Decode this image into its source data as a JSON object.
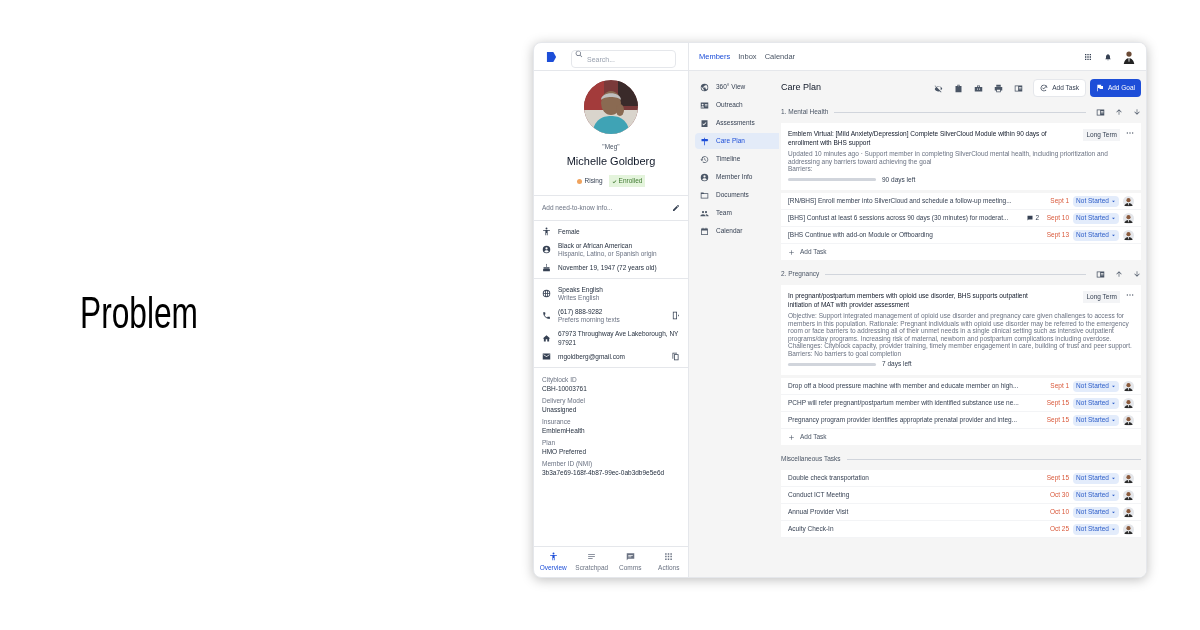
{
  "slide_title": "Problem",
  "app": {
    "search": {
      "placeholder": "Search..."
    },
    "top_tabs": [
      {
        "label": "Members",
        "selected": true
      },
      {
        "label": "Inbox",
        "selected": false
      },
      {
        "label": "Calendar",
        "selected": false
      }
    ],
    "member": {
      "nickname": "\"Meg\"",
      "name": "Michelle Goldberg",
      "status": {
        "label": "Rising",
        "color": "#f0a35e"
      },
      "badge": "Enrolled",
      "need_to_know": {
        "placeholder": "Add need-to-know info..."
      },
      "groups": [
        [
          {
            "kind": "gender",
            "text": "Female"
          },
          {
            "kind": "person",
            "text": "Black or African American",
            "sub": "Hispanic, Latino, or Spanish origin"
          },
          {
            "kind": "birthday",
            "text": "November 19, 1947 (72 years old)"
          }
        ],
        [
          {
            "kind": "language",
            "text": "Speaks English",
            "sub": "Writes English"
          },
          {
            "kind": "phone",
            "text": "(617) 888-9282",
            "sub": "Prefers morning texts"
          },
          {
            "kind": "home",
            "text": "67973 Throughway Ave Lakeborough, NY 97921"
          },
          {
            "kind": "email",
            "text": "mgoldberg@gmail.com"
          }
        ]
      ],
      "details": [
        {
          "label": "Cityblock ID",
          "value": "CBH-10003761"
        },
        {
          "label": "Delivery Model",
          "value": "Unassigned"
        },
        {
          "label": "Insurance",
          "value": "EmblemHealth"
        },
        {
          "label": "Plan",
          "value": "HMO Preferred"
        },
        {
          "label": "Member ID (NMI)",
          "value": "3b3a7e69-168f-4b87-99ec-0ab3db9e5e6d"
        }
      ]
    },
    "bottom_tabs": [
      {
        "kind": "overview",
        "label": "Overview",
        "selected": true
      },
      {
        "kind": "scratchpad",
        "label": "Scratchpad",
        "selected": false
      },
      {
        "kind": "comms",
        "label": "Comms",
        "selected": false
      },
      {
        "kind": "actions",
        "label": "Actions",
        "selected": false
      }
    ],
    "side_nav": [
      {
        "kind": "globe",
        "label": "360° View",
        "selected": false
      },
      {
        "kind": "contact",
        "label": "Outreach",
        "selected": false
      },
      {
        "kind": "check",
        "label": "Assessments",
        "selected": false
      },
      {
        "kind": "sign",
        "label": "Care Plan",
        "selected": true
      },
      {
        "kind": "history",
        "label": "Timeline",
        "selected": false
      },
      {
        "kind": "person",
        "label": "Member Info",
        "selected": false
      },
      {
        "kind": "folder",
        "label": "Documents",
        "selected": false
      },
      {
        "kind": "team",
        "label": "Team",
        "selected": false
      },
      {
        "kind": "calendar",
        "label": "Calendar",
        "selected": false
      }
    ],
    "care_plan": {
      "title": "Care Plan",
      "add_task": "Add Task",
      "add_goal": "Add Goal",
      "sections": [
        {
          "title": "1. Mental Health",
          "goal": {
            "title": "Emblem Virtual: [Mild Anxiety/Depression] Complete SilverCloud Module within 90 days of enrollment with BHS support",
            "term": "Long Term",
            "description": "Updated 10 minutes ago · Support member in completing SilverCloud mental health, including prioritization and addressing any barriers toward achieving the goal",
            "barriers": "Barriers:",
            "level": 1,
            "days_left": "90 days left"
          },
          "tasks": [
            {
              "text": "[RN/BHS] Enroll member into SilverCloud and schedule a follow-up meeting...",
              "date": "Sept 1",
              "status": "Not Started"
            },
            {
              "text": "[BHS] Confust at least 6 sessions across 90 days (30 minutes) for moderat...",
              "comments": "2",
              "date": "Sept 10",
              "status": "Not Started"
            },
            {
              "text": "[BHS Continue with add-on Module or Offboarding",
              "date": "Sept 13",
              "status": "Not Started"
            }
          ],
          "add_task": "Add Task"
        },
        {
          "title": "2. Pregnancy",
          "goal": {
            "title": "In pregnant/postpartum members with opioid use disorder, BHS supports outpatient initiation of MAT with provider assessment",
            "term": "Long Term",
            "description": "Objective: Support integrated management of opioid use disorder and pregnancy care given challenges to access for members in this population. Rationale: Pregnant individuals with opioid use disorder may be referred to the emergency room or face barriers to addressing all of their unmet needs in a single clinical setting such as intensive outpatient programs/day programs. Increasing risk of maternal, newborn and postpartum complications including overdose. Challenges: Cityblock capacity, provider training, timely member engagement in care, building of trust and peer support.",
            "barriers": "Barriers: No barriers to goal completion",
            "level": 1,
            "days_left": "7 days left"
          },
          "tasks": [
            {
              "text": "Drop off a blood pressure machine with member and educate member on high...",
              "date": "Sept 1",
              "status": "Not Started"
            },
            {
              "text": "PCHP will refer pregnant/postpartum member with identified substance use ne...",
              "date": "Sept 15",
              "status": "Not Started"
            },
            {
              "text": "Pregnancy program provider identifies appropriate prenatal provider and integ...",
              "date": "Sept 15",
              "status": "Not Started"
            }
          ],
          "add_task": "Add Task"
        },
        {
          "title": "Miscellaneous Tasks",
          "tasks": [
            {
              "text": "Double check transportation",
              "date": "Sept 15",
              "status": "Not Started"
            },
            {
              "text": "Conduct ICT Meeting",
              "date": "Oct 30",
              "status": "Not Started"
            },
            {
              "text": "Annual Provider Visit",
              "date": "Oct 10",
              "status": "Not Started"
            },
            {
              "text": "Acuity Check-In",
              "date": "Oct 25",
              "status": "Not Started"
            }
          ]
        }
      ]
    }
  }
}
